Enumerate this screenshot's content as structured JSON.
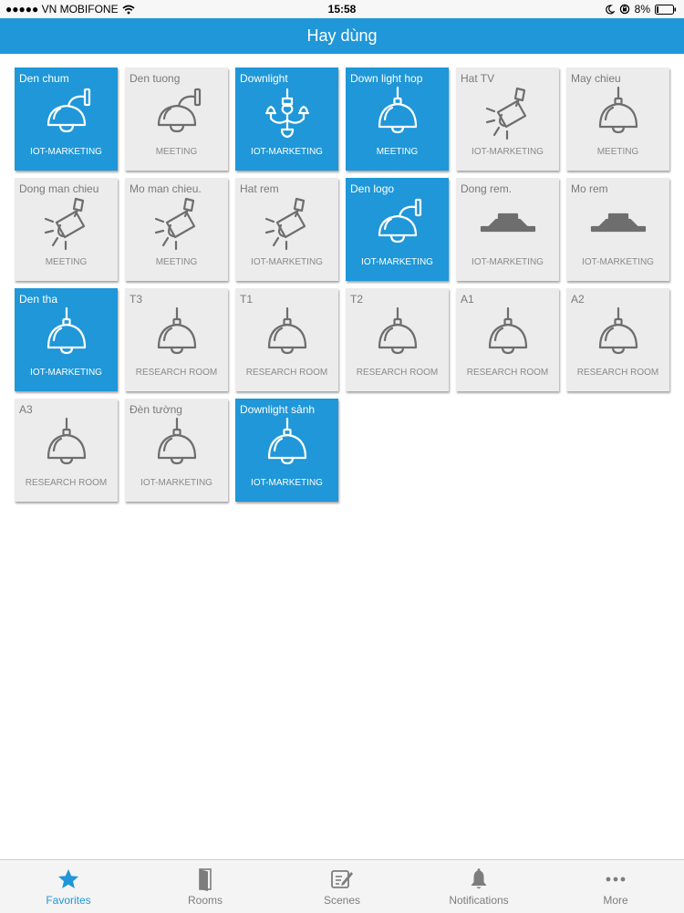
{
  "status_bar": {
    "carrier": "●●●●● VN MOBIFONE",
    "time": "15:58",
    "battery": "8%"
  },
  "header": {
    "title": "Hay dùng"
  },
  "tiles": [
    {
      "name": "Den chum",
      "room": "IOT-MARKETING",
      "active": true,
      "icon": "wall-lamp-icon"
    },
    {
      "name": "Den tuong",
      "room": "MEETING",
      "active": false,
      "icon": "wall-lamp-icon"
    },
    {
      "name": "Downlight",
      "room": "IOT-MARKETING",
      "active": true,
      "icon": "chandelier-icon"
    },
    {
      "name": "Down light hop",
      "room": "MEETING",
      "active": true,
      "icon": "pendant-lamp-icon"
    },
    {
      "name": "Hat TV",
      "room": "IOT-MARKETING",
      "active": false,
      "icon": "spotlight-icon"
    },
    {
      "name": "May chieu",
      "room": "MEETING",
      "active": false,
      "icon": "pendant-lamp-icon"
    },
    {
      "name": "Dong man chieu",
      "room": "MEETING",
      "active": false,
      "icon": "spotlight-icon"
    },
    {
      "name": "Mo man chieu.",
      "room": "MEETING",
      "active": false,
      "icon": "spotlight-icon"
    },
    {
      "name": "Hat rem",
      "room": "IOT-MARKETING",
      "active": false,
      "icon": "spotlight-icon"
    },
    {
      "name": "Den logo",
      "room": "IOT-MARKETING",
      "active": true,
      "icon": "wall-lamp-icon"
    },
    {
      "name": "Dong rem.",
      "room": "IOT-MARKETING",
      "active": false,
      "icon": "ceiling-light-icon"
    },
    {
      "name": "Mo rem",
      "room": "IOT-MARKETING",
      "active": false,
      "icon": "ceiling-light-icon"
    },
    {
      "name": "Den tha",
      "room": "IOT-MARKETING",
      "active": true,
      "icon": "pendant-lamp-icon"
    },
    {
      "name": "T3",
      "room": "RESEARCH ROOM",
      "active": false,
      "icon": "pendant-lamp-icon"
    },
    {
      "name": "T1",
      "room": "RESEARCH ROOM",
      "active": false,
      "icon": "pendant-lamp-icon"
    },
    {
      "name": "T2",
      "room": "RESEARCH ROOM",
      "active": false,
      "icon": "pendant-lamp-icon"
    },
    {
      "name": "A1",
      "room": "RESEARCH ROOM",
      "active": false,
      "icon": "pendant-lamp-icon"
    },
    {
      "name": "A2",
      "room": "RESEARCH ROOM",
      "active": false,
      "icon": "pendant-lamp-icon"
    },
    {
      "name": "A3",
      "room": "RESEARCH ROOM",
      "active": false,
      "icon": "pendant-lamp-icon"
    },
    {
      "name": "Đèn tường",
      "room": "IOT-MARKETING",
      "active": false,
      "icon": "pendant-lamp-icon"
    },
    {
      "name": "Downlight sảnh",
      "room": "IOT-MARKETING",
      "active": true,
      "icon": "pendant-lamp-icon"
    }
  ],
  "tabbar": {
    "items": [
      {
        "label": "Favorites",
        "icon": "star-icon",
        "active": true
      },
      {
        "label": "Rooms",
        "icon": "door-icon",
        "active": false
      },
      {
        "label": "Scenes",
        "icon": "edit-note-icon",
        "active": false
      },
      {
        "label": "Notifications",
        "icon": "bell-icon",
        "active": false
      },
      {
        "label": "More",
        "icon": "more-dots-icon",
        "active": false
      }
    ]
  },
  "colors": {
    "accent": "#1f97d8",
    "tile_inactive": "#ececec",
    "icon_inactive": "#6e6e6e"
  }
}
